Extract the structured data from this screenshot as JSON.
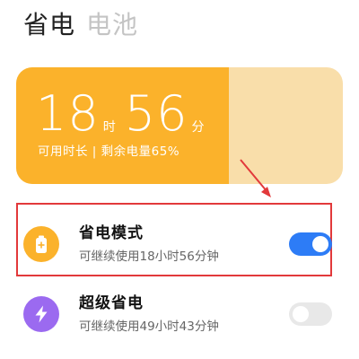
{
  "tabs": [
    {
      "label": "省电",
      "active": true
    },
    {
      "label": "电池",
      "active": false
    }
  ],
  "battery": {
    "hours": "18",
    "hours_unit": "时",
    "minutes": "56",
    "minutes_unit": "分",
    "summary": "可用时长 | 剩余电量65%",
    "remaining_fraction": 0.65
  },
  "modes": [
    {
      "title": "省电模式",
      "description": "可继续使用18小时56分钟",
      "enabled": true,
      "icon": "battery-plus-icon",
      "icon_color": "#fbb22b"
    },
    {
      "title": "超级省电",
      "description": "可继续使用49小时43分钟",
      "enabled": false,
      "icon": "lightning-icon",
      "icon_color": "#9b6af0"
    }
  ],
  "colors": {
    "battery_fill": "#fbb22b",
    "battery_track": "#f9deaa",
    "toggle_on": "#2d7cf6",
    "toggle_off": "#e8e8e8",
    "annotation": "#e2393b"
  }
}
